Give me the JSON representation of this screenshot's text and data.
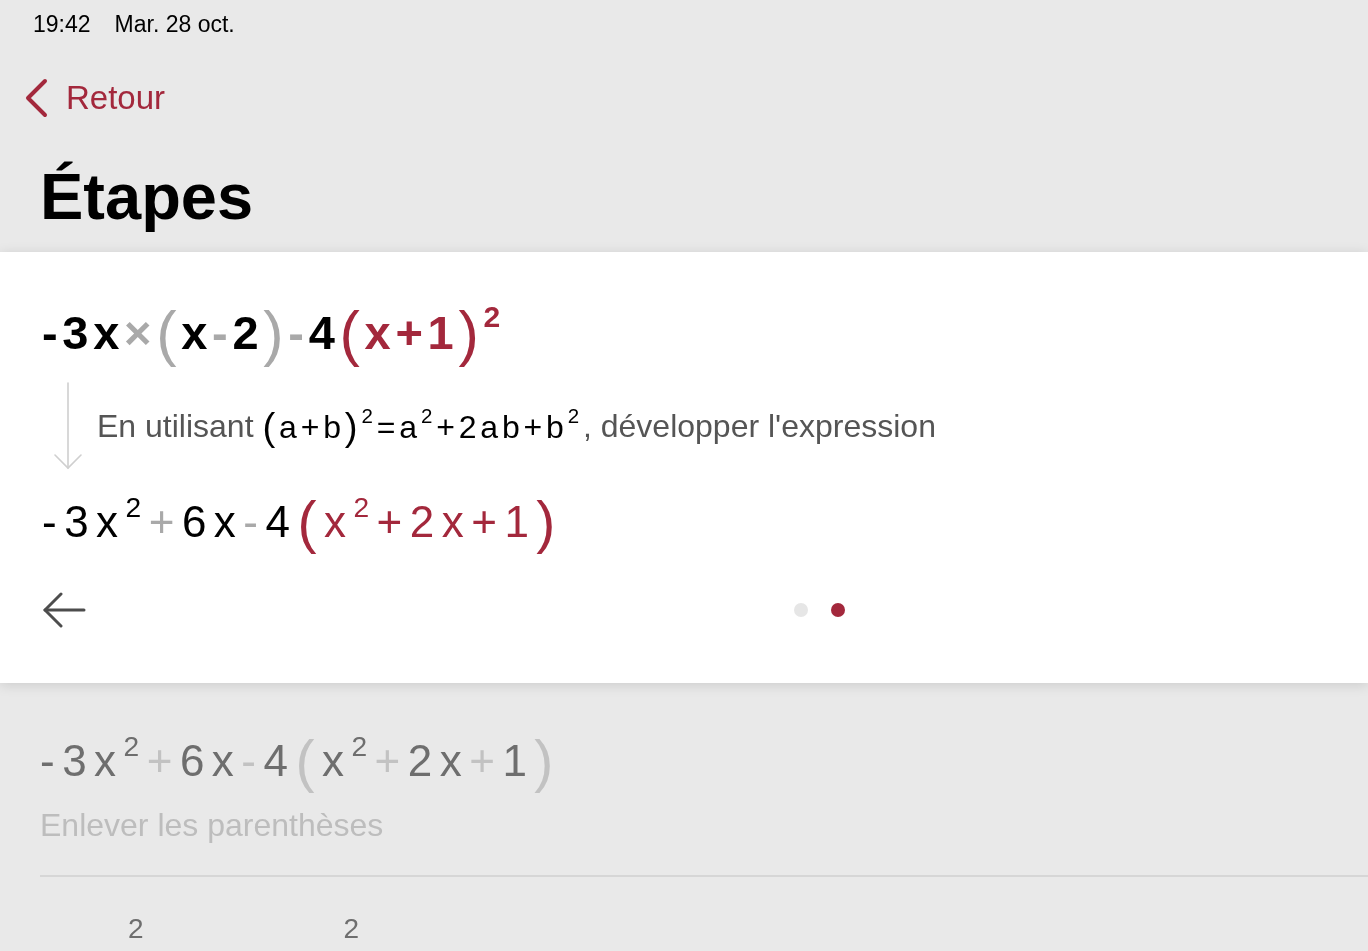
{
  "status_bar": {
    "time": "19:42",
    "date": "Mar. 28 oct."
  },
  "nav": {
    "back_label": "Retour",
    "title": "Étapes"
  },
  "current_step": {
    "from": [
      {
        "text": "-3x",
        "kind": "text",
        "color": "#000000"
      },
      {
        "text": "×",
        "kind": "text",
        "color": "#a9a9a9"
      },
      {
        "text": "(",
        "kind": "paren",
        "color": "#a9a9a9"
      },
      {
        "text": "x",
        "kind": "text",
        "color": "#000000"
      },
      {
        "text": "-",
        "kind": "text",
        "color": "#a9a9a9"
      },
      {
        "text": "2",
        "kind": "text",
        "color": "#000000"
      },
      {
        "text": ")",
        "kind": "paren",
        "color": "#a9a9a9"
      },
      {
        "text": "-",
        "kind": "text",
        "color": "#a9a9a9"
      },
      {
        "text": "4",
        "kind": "text",
        "color": "#000000"
      },
      {
        "text": "(",
        "kind": "paren",
        "color": "#a3283c"
      },
      {
        "text": "x+1",
        "kind": "text",
        "color": "#a3283c"
      },
      {
        "text": ")",
        "kind": "paren",
        "color": "#a3283c"
      },
      {
        "text": "2",
        "kind": "sup",
        "color": "#a3283c"
      }
    ],
    "hint": {
      "prefix": "En utilisant",
      "formula": [
        {
          "text": "(",
          "kind": "paren",
          "color": "#000000"
        },
        {
          "text": "a+b",
          "kind": "text",
          "color": "#000000"
        },
        {
          "text": ")",
          "kind": "paren",
          "color": "#000000"
        },
        {
          "text": "2",
          "kind": "sup",
          "color": "#000000"
        },
        {
          "text": "=a",
          "kind": "text",
          "color": "#000000"
        },
        {
          "text": "2",
          "kind": "sup",
          "color": "#000000"
        },
        {
          "text": "+2ab+b",
          "kind": "text",
          "color": "#000000"
        },
        {
          "text": "2",
          "kind": "sup",
          "color": "#000000"
        }
      ],
      "suffix": ", développer l'expression"
    },
    "to": [
      {
        "text": "-3x",
        "kind": "text",
        "color": "#000000"
      },
      {
        "text": "2",
        "kind": "sup",
        "color": "#000000"
      },
      {
        "text": "+",
        "kind": "text",
        "color": "#a9a9a9"
      },
      {
        "text": "6x",
        "kind": "text",
        "color": "#000000"
      },
      {
        "text": "-",
        "kind": "text",
        "color": "#a9a9a9"
      },
      {
        "text": "4",
        "kind": "text",
        "color": "#000000"
      },
      {
        "text": "(",
        "kind": "paren",
        "color": "#a3283c"
      },
      {
        "text": "x",
        "kind": "text",
        "color": "#a3283c"
      },
      {
        "text": "2",
        "kind": "sup",
        "color": "#a3283c"
      },
      {
        "text": "+2x+1",
        "kind": "text",
        "color": "#a3283c"
      },
      {
        "text": ")",
        "kind": "paren",
        "color": "#a3283c"
      }
    ],
    "pager": {
      "dots": [
        {
          "selected": false
        },
        {
          "selected": true
        }
      ]
    }
  },
  "next_steps": [
    {
      "expression": [
        {
          "text": "-3x",
          "kind": "text",
          "color": "#6e6e6e"
        },
        {
          "text": "2",
          "kind": "sup",
          "color": "#6e6e6e"
        },
        {
          "text": "+",
          "kind": "text",
          "color": "#c2c2c2"
        },
        {
          "text": "6x",
          "kind": "text",
          "color": "#6e6e6e"
        },
        {
          "text": "-",
          "kind": "text",
          "color": "#c2c2c2"
        },
        {
          "text": "4",
          "kind": "text",
          "color": "#6e6e6e"
        },
        {
          "text": "(",
          "kind": "paren",
          "color": "#c2c2c2"
        },
        {
          "text": "x",
          "kind": "text",
          "color": "#6e6e6e"
        },
        {
          "text": "2",
          "kind": "sup",
          "color": "#6e6e6e"
        },
        {
          "text": "+",
          "kind": "text",
          "color": "#c2c2c2"
        },
        {
          "text": "2x",
          "kind": "text",
          "color": "#6e6e6e"
        },
        {
          "text": "+",
          "kind": "text",
          "color": "#c2c2c2"
        },
        {
          "text": "1",
          "kind": "text",
          "color": "#6e6e6e"
        },
        {
          "text": ")",
          "kind": "paren",
          "color": "#c2c2c2"
        }
      ],
      "description": "Enlever les parenthèses"
    }
  ],
  "cut_off_step": {
    "visible_exponents": [
      "2",
      "2"
    ]
  }
}
